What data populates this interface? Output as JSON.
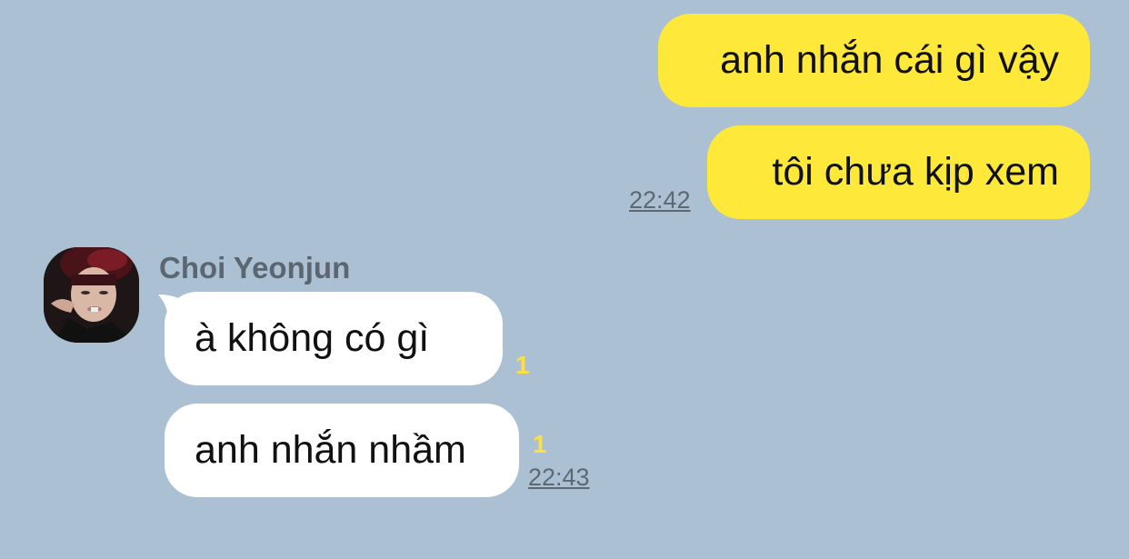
{
  "chat": {
    "outgoing": [
      {
        "text": "anh nhắn cái gì vậy"
      },
      {
        "text": "tôi chưa kịp xem",
        "time": "22:42"
      }
    ],
    "sender": {
      "name": "Choi Yeonjun",
      "avatar": "profile-photo"
    },
    "incoming": [
      {
        "text": "à không có gì",
        "unread": "1"
      },
      {
        "text": "anh nhắn nhầm",
        "unread": "1",
        "time": "22:43"
      }
    ]
  },
  "colors": {
    "background": "#abc1d3",
    "outgoing_bubble": "#fee83a",
    "incoming_bubble": "#ffffff",
    "unread_count": "#fde040",
    "timestamp": "#5d6873",
    "sender_name": "#5b6670"
  }
}
